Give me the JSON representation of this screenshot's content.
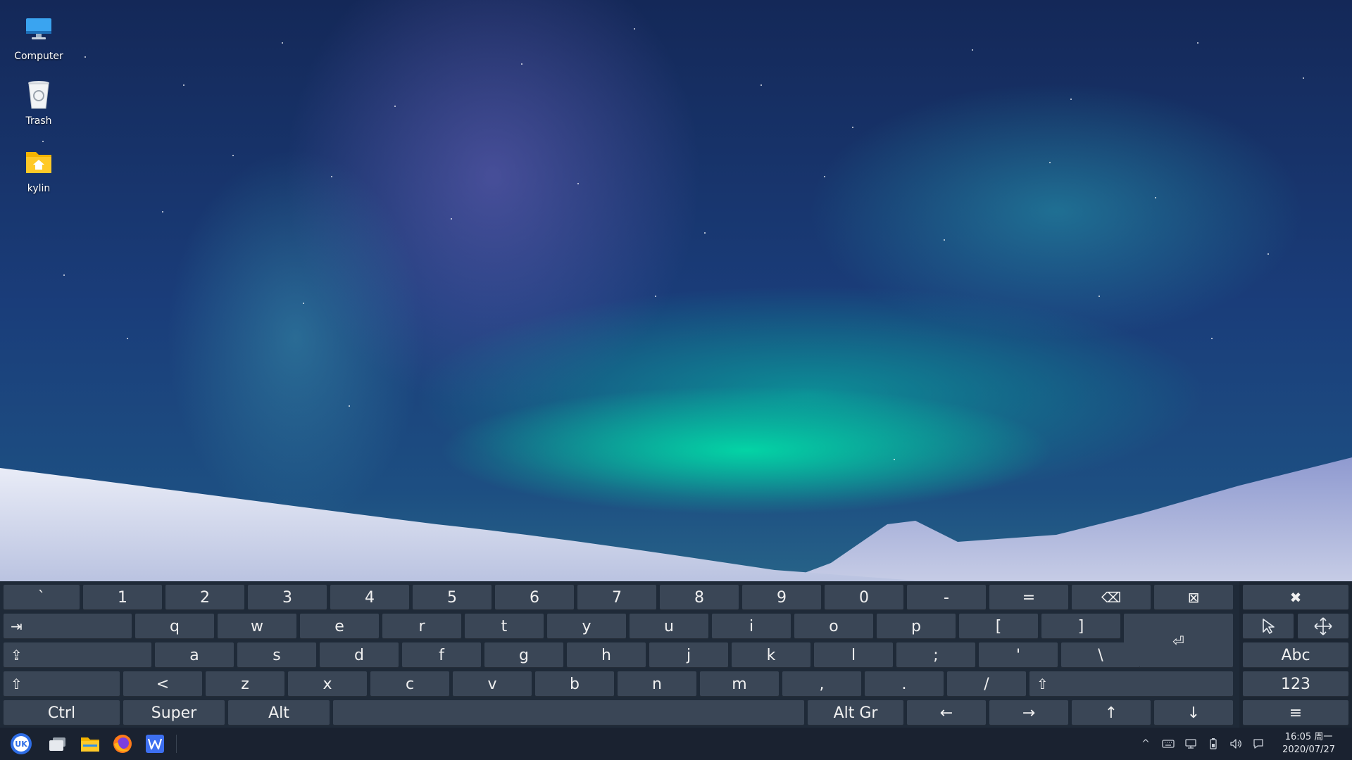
{
  "desktop": {
    "icons": [
      {
        "label": "Computer"
      },
      {
        "label": "Trash"
      },
      {
        "label": "kylin"
      }
    ]
  },
  "keyboard": {
    "row1": [
      "`",
      "1",
      "2",
      "3",
      "4",
      "5",
      "6",
      "7",
      "8",
      "9",
      "0",
      "-",
      "=",
      "⌫",
      "⊠"
    ],
    "row2": [
      "⇥",
      "q",
      "w",
      "e",
      "r",
      "t",
      "y",
      "u",
      "i",
      "o",
      "p",
      "[",
      "]"
    ],
    "row3": [
      "⇪",
      "a",
      "s",
      "d",
      "f",
      "g",
      "h",
      "j",
      "k",
      "l",
      ";",
      "'",
      "\\"
    ],
    "row4": [
      "⇧",
      "<",
      "z",
      "x",
      "c",
      "v",
      "b",
      "n",
      "m",
      ",",
      ".",
      "/",
      "⇧"
    ],
    "row5": [
      "Ctrl",
      "Super",
      "Alt",
      "",
      "Alt Gr",
      "←",
      "→",
      "↑",
      "↓"
    ],
    "enter": "⏎",
    "side": {
      "close": "✖",
      "pointer": "pointer-icon",
      "move": "move-icon",
      "abc": "Abc",
      "num": "123",
      "menu": "≡"
    }
  },
  "taskbar": {
    "apps": [
      "start-menu",
      "multitask-view",
      "file-manager",
      "firefox",
      "wps-writer"
    ],
    "tray": [
      "^",
      "keyboard-icon",
      "network-icon",
      "battery-icon",
      "volume-icon",
      "notification-icon"
    ],
    "time": "16:05 周一",
    "date": "2020/07/27"
  }
}
